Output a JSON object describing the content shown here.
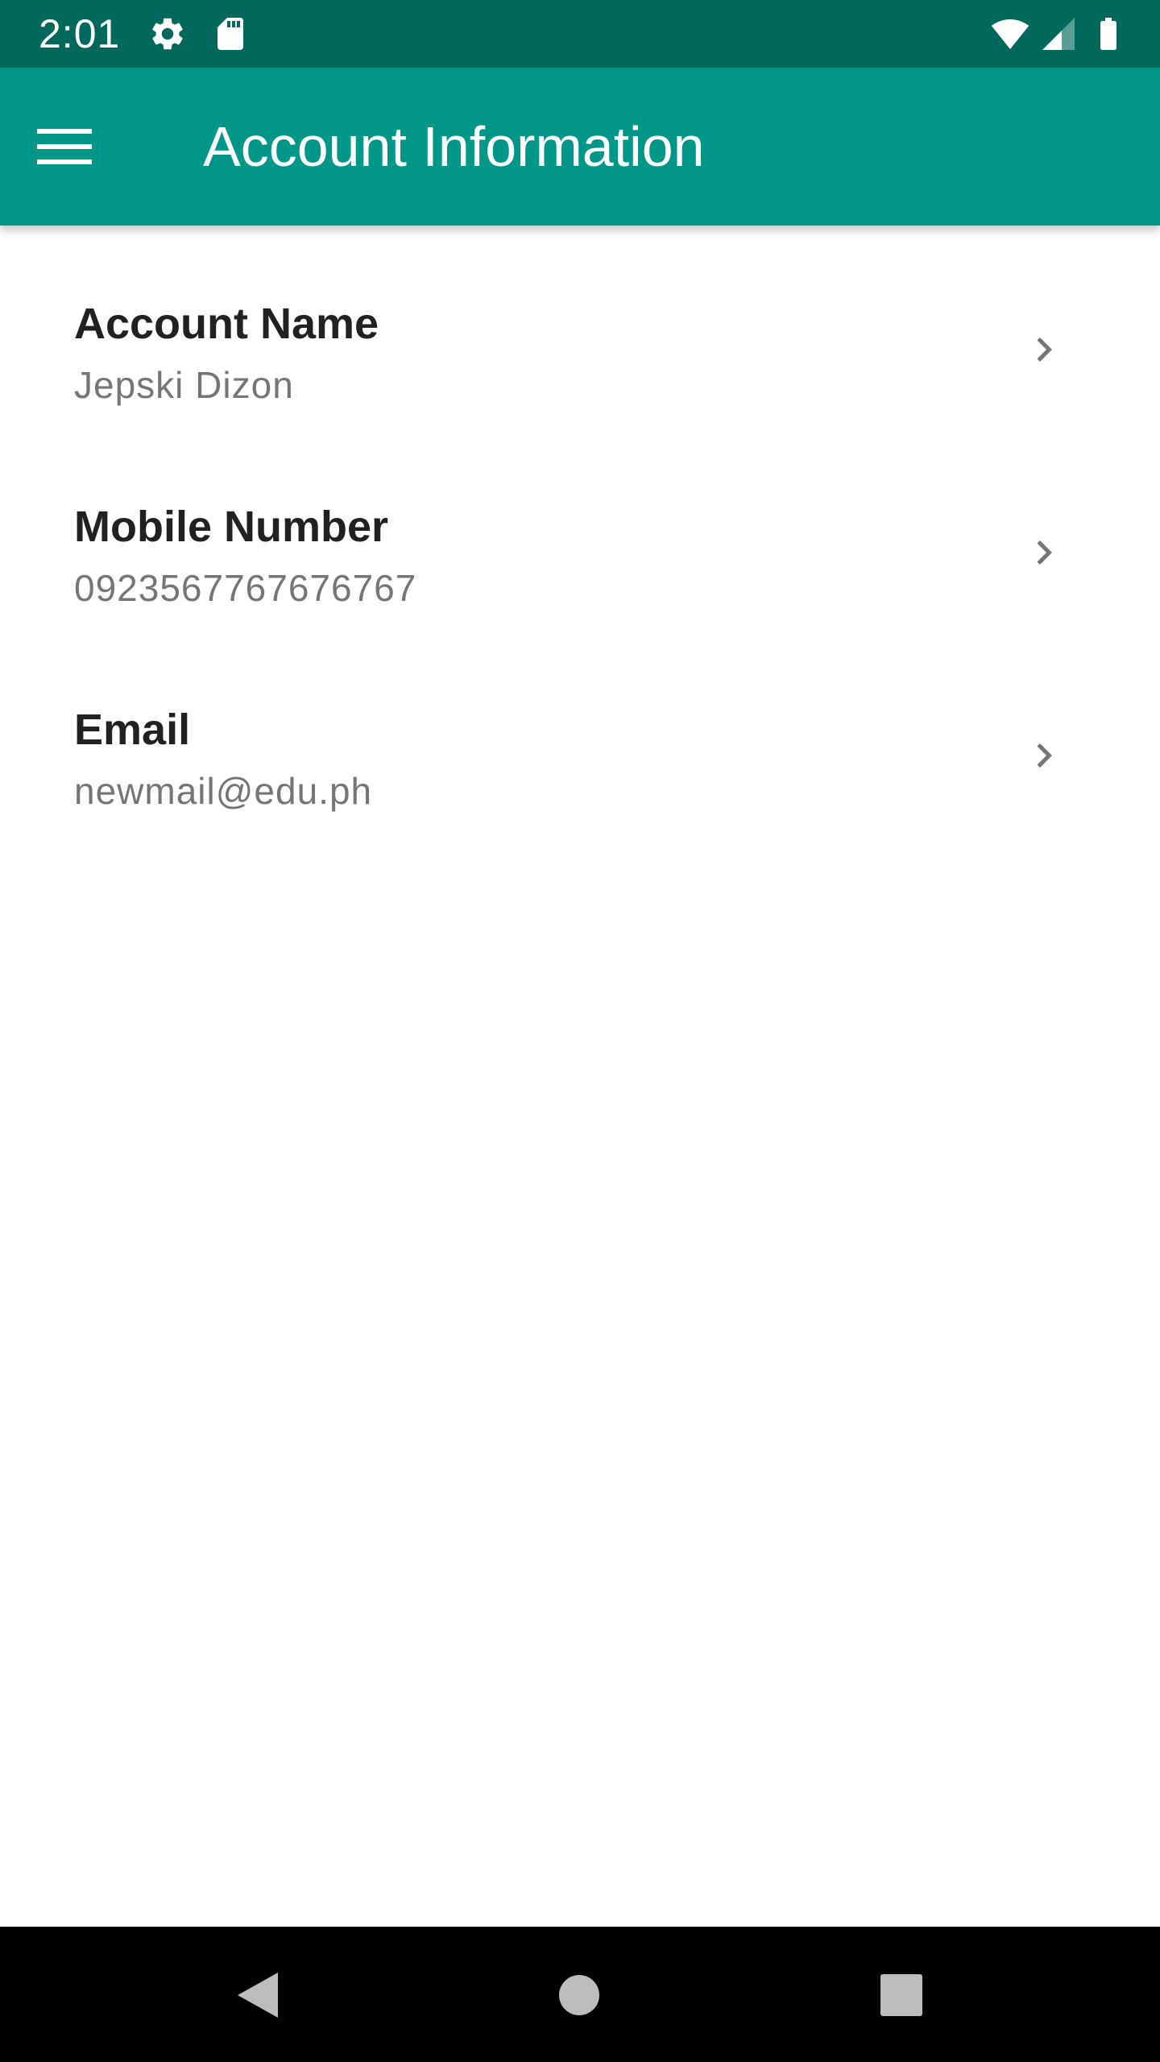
{
  "status_bar": {
    "time": "2:01",
    "background": "#00695c",
    "icons": [
      "settings-icon",
      "sdcard-icon",
      "wifi-icon",
      "signal-icon",
      "battery-icon"
    ]
  },
  "app_bar": {
    "title": "Account Information",
    "background": "#009688",
    "menu_icon": "menu-icon"
  },
  "account_info": {
    "items": [
      {
        "label": "Account Name",
        "value": "Jepski Dizon",
        "icon": "chevron-right-icon"
      },
      {
        "label": "Mobile Number",
        "value": "0923567767676767",
        "icon": "chevron-right-icon"
      },
      {
        "label": "Email",
        "value": "newmail@edu.ph",
        "icon": "chevron-right-icon"
      }
    ]
  },
  "nav_bar": {
    "buttons": [
      "back-icon",
      "home-icon",
      "recents-icon"
    ]
  }
}
